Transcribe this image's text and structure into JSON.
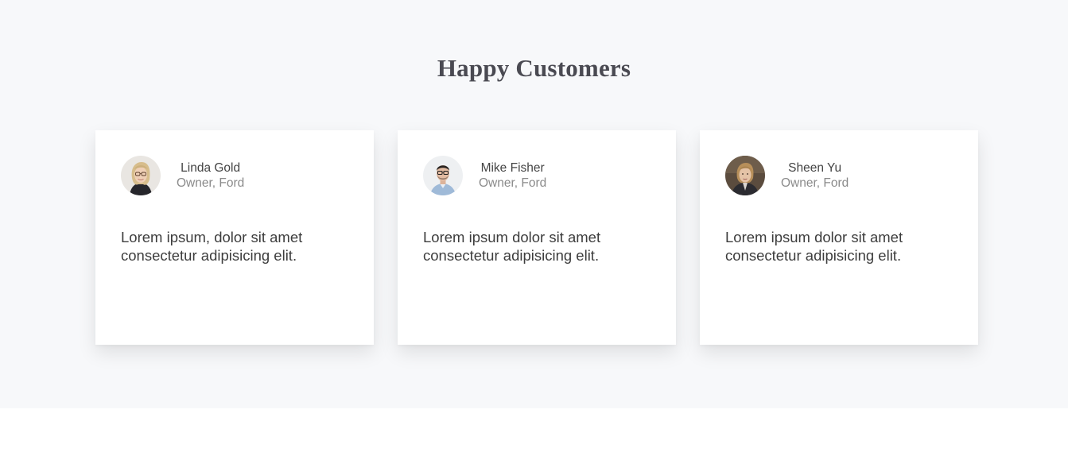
{
  "section": {
    "title": "Happy Customers"
  },
  "testimonials": [
    {
      "name": "Linda Gold",
      "role": "Owner, Ford",
      "quote": "Lorem ipsum, dolor sit amet consectetur adipisicing elit.",
      "avatar": "woman-blonde-glasses-photo"
    },
    {
      "name": "Mike Fisher",
      "role": "Owner, Ford",
      "quote": "Lorem ipsum dolor sit amet consectetur adipisicing elit.",
      "avatar": "man-glasses-blue-shirt-photo"
    },
    {
      "name": "Sheen Yu",
      "role": "Owner, Ford",
      "quote": "Lorem ipsum dolor sit amet consectetur adipisicing elit.",
      "avatar": "woman-blazer-photo"
    }
  ],
  "colors": {
    "section_background": "#f7f8fa",
    "card_background": "#ffffff",
    "title": "#4a4a52",
    "muted": "#8a8a8a"
  }
}
